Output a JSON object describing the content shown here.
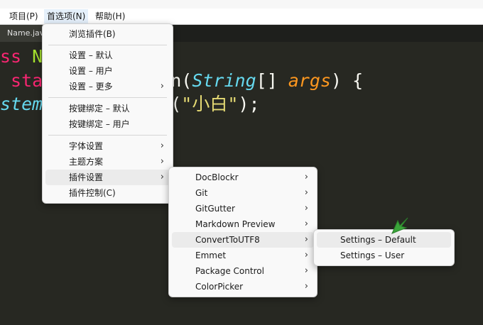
{
  "menubar": {
    "items": [
      {
        "label": "项目(P)"
      },
      {
        "label": "首选项(N)"
      },
      {
        "label": "帮助(H)"
      }
    ]
  },
  "tab": {
    "label": "Name.java"
  },
  "code": {
    "line1": {
      "kw": "ss ",
      "cls": "N"
    },
    "line2": {
      "kw": " sta",
      "mid": "n(",
      "typ": "String",
      "brk": "[] ",
      "arg": "args",
      "end": ") {"
    },
    "line3": {
      "typ": "stem",
      "open": "(",
      "str": "\"小白\"",
      "end": ");"
    }
  },
  "menu_preferences": {
    "items": [
      {
        "label": "浏览插件(B)"
      },
      {
        "label": "设置 – 默认"
      },
      {
        "label": "设置 – 用户"
      },
      {
        "label": "设置 – 更多",
        "arrow": "›"
      },
      {
        "label": "按键绑定 – 默认"
      },
      {
        "label": "按键绑定 – 用户"
      },
      {
        "label": "字体设置",
        "arrow": "›"
      },
      {
        "label": "主题方案",
        "arrow": "›"
      },
      {
        "label": "插件设置",
        "arrow": "›"
      },
      {
        "label": "插件控制(C)"
      }
    ]
  },
  "menu_plugins": {
    "items": [
      {
        "label": "DocBlockr",
        "arrow": "›"
      },
      {
        "label": "Git",
        "arrow": "›"
      },
      {
        "label": "GitGutter",
        "arrow": "›"
      },
      {
        "label": "Markdown Preview",
        "arrow": "›"
      },
      {
        "label": "ConvertToUTF8",
        "arrow": "›"
      },
      {
        "label": "Emmet",
        "arrow": "›"
      },
      {
        "label": "Package Control",
        "arrow": "›"
      },
      {
        "label": "ColorPicker",
        "arrow": "›"
      }
    ]
  },
  "menu_convert": {
    "items": [
      {
        "label": "Settings – Default"
      },
      {
        "label": "Settings – User"
      }
    ]
  },
  "colors": {
    "editor_bg": "#272822",
    "keyword": "#f92672",
    "class": "#a6e22e",
    "type": "#66d9ef",
    "argument": "#fd971f",
    "string": "#e6db74",
    "cursor": "#3aa53a"
  }
}
